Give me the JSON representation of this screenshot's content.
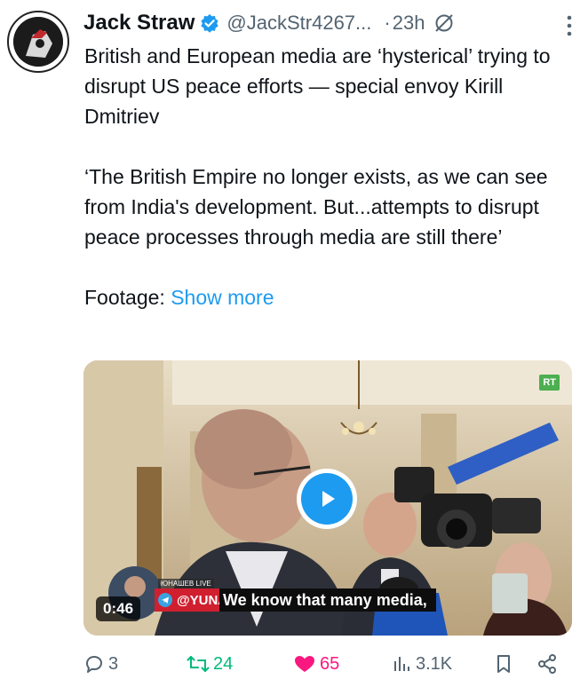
{
  "author": {
    "name": "Jack Straw",
    "handle": "@JackStr4267...",
    "separator": "·",
    "time": "23h"
  },
  "tweet": {
    "paragraph1": "British and European media are ‘hysterical’ trying to disrupt US peace efforts — special envoy Kirill Dmitriev",
    "paragraph2": "‘The British Empire no longer exists, as we can see from India's development. But...attempts to disrupt peace processes through media are still there’",
    "footage_label": "Footage: ",
    "show_more": "Show more"
  },
  "video": {
    "duration": "0:46",
    "channel_label": "ЮНАШЕВ LIVE",
    "channel_handle": "@YUNA",
    "caption": "We know that many media,",
    "logo_text": "RT"
  },
  "actions": {
    "replies": "3",
    "reposts": "24",
    "likes": "65",
    "views": "3.1K"
  },
  "colors": {
    "accent": "#1d9bf0",
    "like": "#f91880",
    "repost": "#00ba7c"
  },
  "icons": [
    "verified-badge-icon",
    "grok-icon",
    "more-options-icon",
    "play-icon",
    "telegram-icon",
    "reply-icon",
    "repost-icon",
    "like-icon",
    "views-icon",
    "bookmark-icon",
    "share-icon"
  ]
}
